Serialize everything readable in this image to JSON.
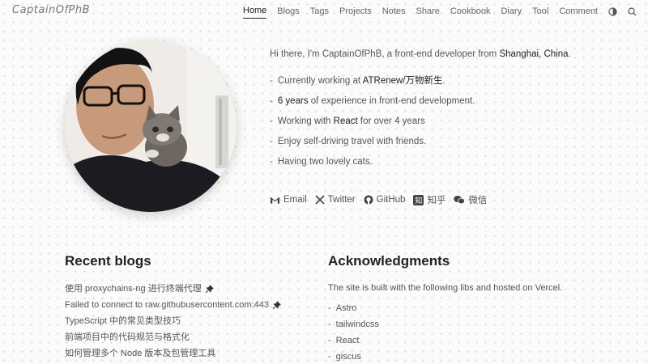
{
  "header": {
    "logo": "CaptainOfPhB",
    "nav": [
      "Home",
      "Blogs",
      "Tags",
      "Projects",
      "Notes",
      "Share",
      "Cookbook",
      "Diary",
      "Tool",
      "Comment"
    ]
  },
  "intro": {
    "greeting_prefix": "Hi there, I'm CaptainOfPhB, a front-end developer from ",
    "location": "Shanghai, China",
    "greeting_suffix": ".",
    "items": [
      {
        "prefix": "Currently working at ",
        "highlight": "ATRenew/万物新生",
        "suffix": "."
      },
      {
        "prefix": "",
        "highlight": "6 years",
        "suffix": " of experience in front-end development."
      },
      {
        "prefix": "Working with ",
        "highlight": "React",
        "suffix": " for over 4 years"
      },
      {
        "prefix": "Enjoy self-driving travel with friends.",
        "highlight": "",
        "suffix": ""
      },
      {
        "prefix": "Having two lovely cats.",
        "highlight": "",
        "suffix": ""
      }
    ]
  },
  "socials": [
    {
      "label": "Email",
      "icon": "email-icon"
    },
    {
      "label": "Twitter",
      "icon": "twitter-icon"
    },
    {
      "label": "GitHub",
      "icon": "github-icon"
    },
    {
      "label": "知乎",
      "icon": "zhihu-icon"
    },
    {
      "label": "微信",
      "icon": "wechat-icon"
    }
  ],
  "blogs": {
    "title": "Recent blogs",
    "items": [
      {
        "text": "使用 proxychains-ng 进行终端代理",
        "pinned": true
      },
      {
        "text": "Failed to connect to raw.githubusercontent.com:443",
        "pinned": true
      },
      {
        "text": "TypeScript 中的常见类型技巧",
        "pinned": false
      },
      {
        "text": "前端项目中的代码规范与格式化",
        "pinned": false
      },
      {
        "text": "如何管理多个 Node 版本及包管理工具",
        "pinned": false
      }
    ]
  },
  "acknowledgments": {
    "title": "Acknowledgments",
    "description": "The site is built with the following libs and hosted on Vercel.",
    "libs": [
      "Astro",
      "tailwindcss",
      "React",
      "giscus"
    ]
  },
  "colors": {
    "text": "#555555",
    "heading": "#222222",
    "background": "#fbfbfb"
  }
}
